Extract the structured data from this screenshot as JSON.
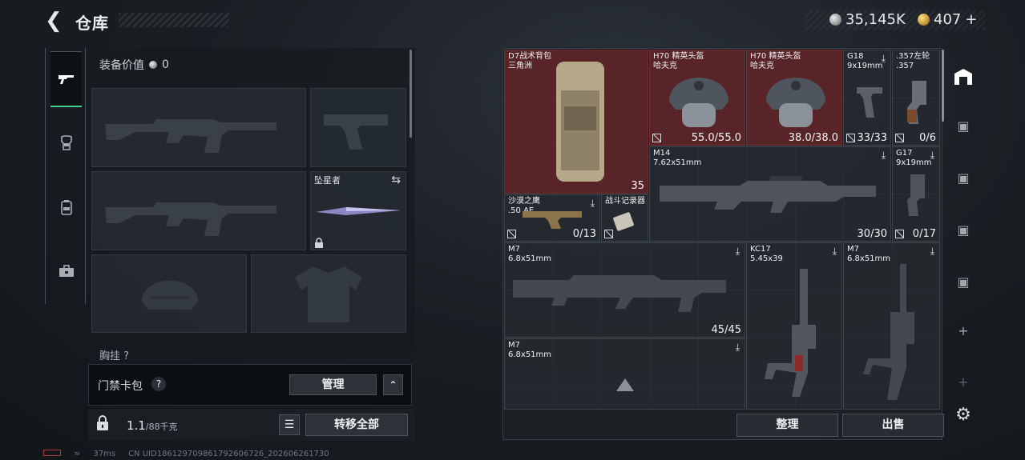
{
  "header": {
    "back_label": "<",
    "title": "仓库",
    "silver_amount": "35,145K",
    "gold_amount": "407",
    "gold_plus": "+"
  },
  "left_rail": {
    "items": [
      {
        "name": "weapons",
        "icon": "gun-icon",
        "active": true
      },
      {
        "name": "armor",
        "icon": "armor-icon",
        "active": false
      },
      {
        "name": "backpack",
        "icon": "backpack-icon",
        "active": false
      },
      {
        "name": "case",
        "icon": "briefcase-icon",
        "active": false
      }
    ]
  },
  "equipment": {
    "value_label": "装备价值",
    "value": "0",
    "melee_slot_label": "坠星者",
    "next_section_label": "胸挂 ?"
  },
  "keycard": {
    "label": "门禁卡包",
    "help": "?",
    "manage_label": "管理",
    "expand_icon": "^"
  },
  "capacity": {
    "current": "1.1",
    "max": "/88千克",
    "transfer_all_label": "转移全部"
  },
  "stash": {
    "items": [
      {
        "id": "backpack",
        "name": "D7战术背包\n三角洲",
        "qty": "35",
        "red": true
      },
      {
        "id": "helmet1",
        "name": "H70 精英头盔\n哈夫克",
        "qty": "55.0/55.0",
        "red": true
      },
      {
        "id": "helmet2",
        "name": "H70 精英头盔\n哈夫克",
        "qty": "38.0/38.0",
        "red": true
      },
      {
        "id": "g18",
        "name": "G18\n9x19mm",
        "qty": "33/33"
      },
      {
        "id": "revolver",
        "name": ".357左轮\n.357",
        "qty": "0/6"
      },
      {
        "id": "m14",
        "name": "M14\n7.62x51mm",
        "qty": "30/30"
      },
      {
        "id": "g17",
        "name": "G17\n9x19mm",
        "qty": "0/17"
      },
      {
        "id": "deagle",
        "name": "沙漠之鹰\n.50 AE",
        "qty": "0/13"
      },
      {
        "id": "recorder",
        "name": "战斗记录器",
        "qty": ""
      },
      {
        "id": "m7a",
        "name": "M7\n6.8x51mm",
        "qty": "45/45"
      },
      {
        "id": "kc17",
        "name": "KC17\n5.45x39",
        "qty": ""
      },
      {
        "id": "m7b",
        "name": "M7\n6.8x51mm",
        "qty": ""
      },
      {
        "id": "m7c",
        "name": "M7\n6.8x51mm",
        "qty": ""
      }
    ],
    "sort_label": "整理",
    "sell_label": "出售"
  },
  "footer": {
    "ping": "37ms",
    "uid": "CN UID1861297098617926067​26_202606261730"
  },
  "colors": {
    "accent_green": "#3fcf8e",
    "item_red": "#6e2628"
  }
}
